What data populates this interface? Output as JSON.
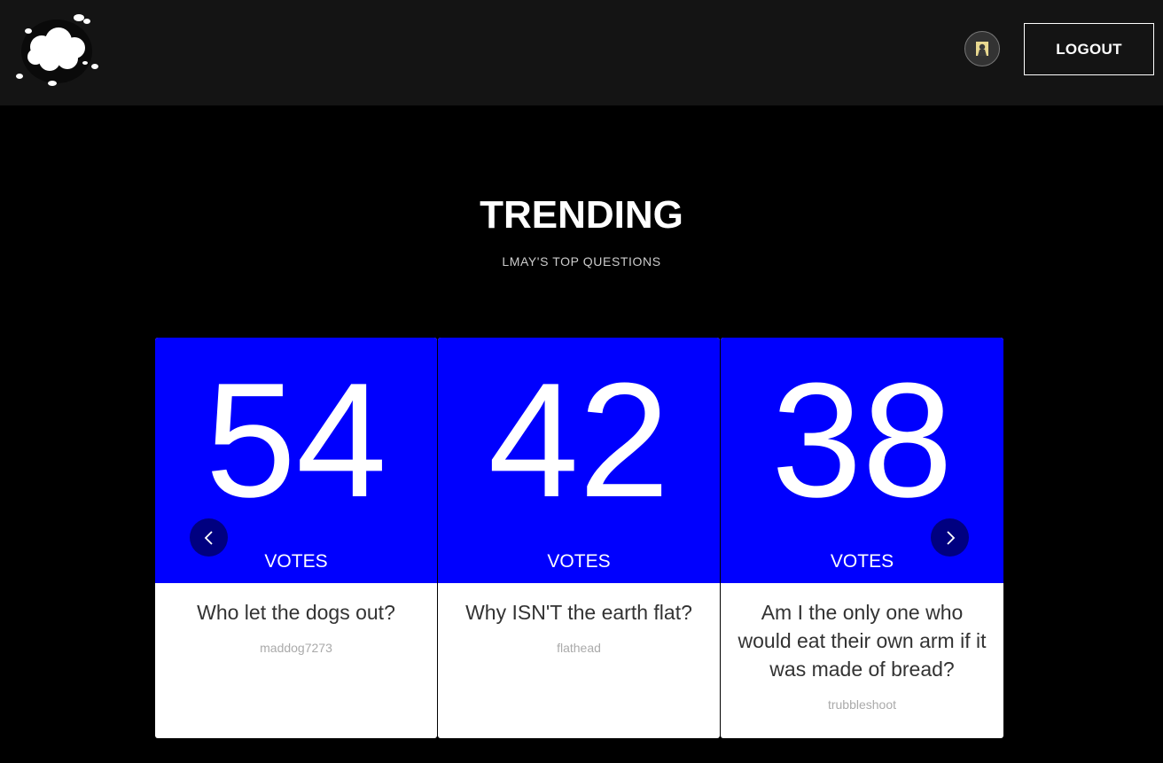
{
  "header": {
    "logout_label": "LOGOUT"
  },
  "main": {
    "title": "TRENDING",
    "subtitle": "LMAY'S TOP QUESTIONS"
  },
  "cards": [
    {
      "votes": "54",
      "votes_label": "VOTES",
      "question": "Who let the dogs out?",
      "author": "maddog7273"
    },
    {
      "votes": "42",
      "votes_label": "VOTES",
      "question": "Why ISN'T the earth flat?",
      "author": "flathead"
    },
    {
      "votes": "38",
      "votes_label": "VOTES",
      "question": "Am I the only one who would eat their own arm if it was made of bread?",
      "author": "trubbleshoot"
    }
  ],
  "colors": {
    "nav_bg": "#141414",
    "page_bg": "#000000",
    "vote_bg": "#0000fe",
    "arrow_bg": "#000080"
  },
  "icons": {
    "logo": "cloud-logo-icon",
    "avatar": "user-avatar-icon",
    "prev": "chevron-left-icon",
    "next": "chevron-right-icon"
  }
}
